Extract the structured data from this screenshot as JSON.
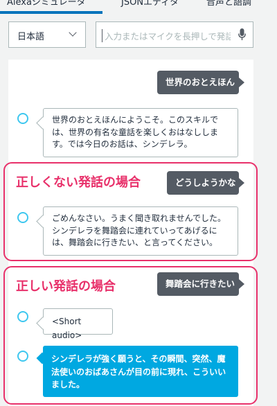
{
  "tabs": [
    {
      "label": "Alexaシミュレータ"
    },
    {
      "label": "JSONエディタ"
    },
    {
      "label": "音声と語調"
    }
  ],
  "input": {
    "language": "日本語",
    "placeholder": "入力またはマイクを長押しで発話"
  },
  "chat": {
    "user1": "世界のおとえほん",
    "alexa1": "世界のおとえほんにようこそ。このスキルでは、世界の有名な童話を楽しくおはなしします。では今日のお話は、シンデレラ。",
    "section1_title": "正しくない発話の場合",
    "user2": "どうしようかな",
    "alexa2": "ごめんなさい。うまく聞き取れませんでした。シンデレラを舞踏会に連れていってあげるには、舞踏会に行きたい、と言ってください。",
    "section2_title": "正しい発話の場合",
    "user3": "舞踏会に行きたい",
    "alexa3": "<Short audio>",
    "alexa4": "シンデレラが強く願うと、その瞬間、突然、魔法使いのおばあさんが目の前に現れ、こういいました。"
  },
  "colors": {
    "accent": "#0073bb",
    "alexa_ring": "#3ec7ef",
    "alexa_blue": "#00a8e1",
    "user_bubble": "#545b64",
    "highlight": "#e8306a"
  },
  "icons": [
    "chevron-down-icon",
    "microphone-icon",
    "alexa-ring-icon"
  ]
}
